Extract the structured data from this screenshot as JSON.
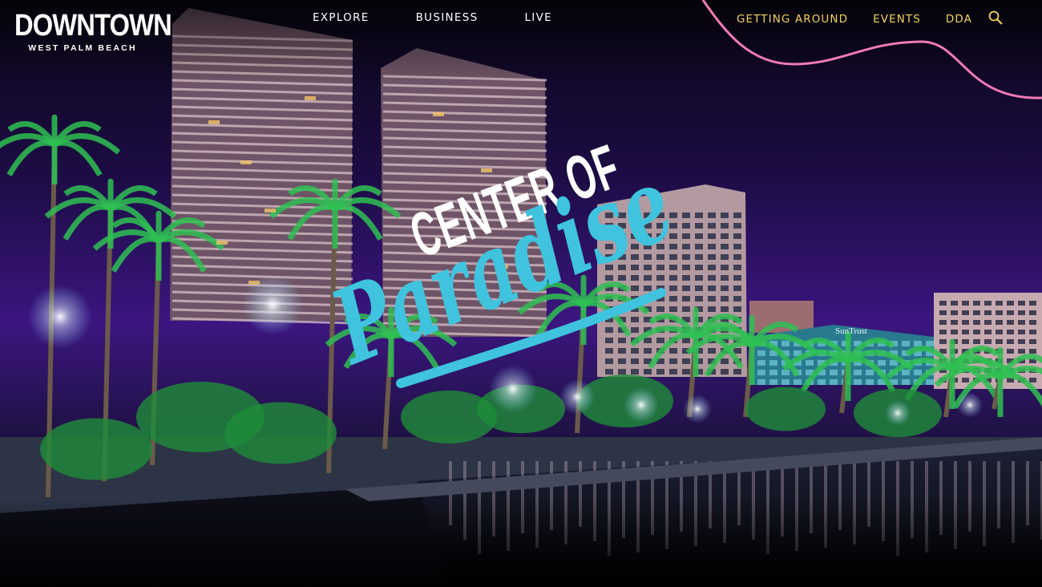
{
  "logo": {
    "main": "DOWNTOWN",
    "sub": "WEST PALM BEACH"
  },
  "nav_primary": [
    "EXPLORE",
    "BUSINESS",
    "LIVE"
  ],
  "nav_secondary": [
    "GETTING AROUND",
    "EVENTS",
    "DDA"
  ],
  "search_icon": "magnifier-icon",
  "hero": {
    "line1": "CENTER OF",
    "line2": "Paradise",
    "building_sign": "SunTrust"
  },
  "colors": {
    "secondary_nav": "#f4d35e",
    "accent_line": "#f07ab8",
    "script": "#3fc3de",
    "sky": "#2a0f5c"
  }
}
